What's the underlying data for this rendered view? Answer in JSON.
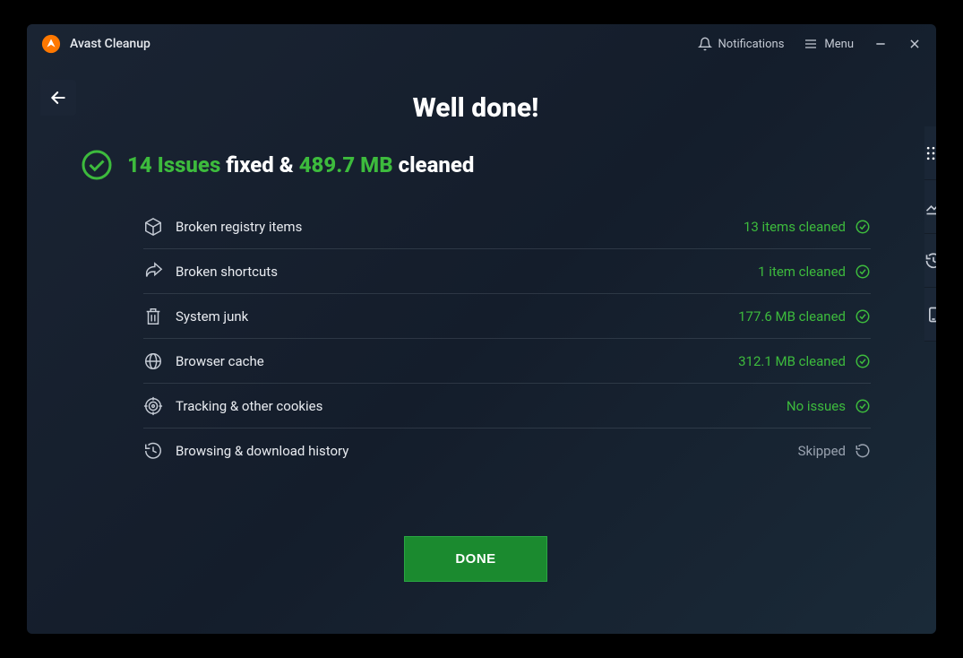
{
  "titlebar": {
    "app_title": "Avast Cleanup",
    "notifications_label": "Notifications",
    "menu_label": "Menu"
  },
  "heading": "Well done!",
  "summary": {
    "issues_count": "14 Issues",
    "middle": " fixed & ",
    "size": "489.7 MB",
    "tail": " cleaned"
  },
  "rows": [
    {
      "label": "Broken registry items",
      "status": "13 items cleaned",
      "status_class": "green",
      "icon": "cube"
    },
    {
      "label": "Broken shortcuts",
      "status": "1 item cleaned",
      "status_class": "green",
      "icon": "share"
    },
    {
      "label": "System junk",
      "status": "177.6 MB cleaned",
      "status_class": "green",
      "icon": "trash"
    },
    {
      "label": "Browser cache",
      "status": "312.1 MB cleaned",
      "status_class": "green",
      "icon": "globe"
    },
    {
      "label": "Tracking & other cookies",
      "status": "No issues",
      "status_class": "green",
      "icon": "target"
    },
    {
      "label": "Browsing & download history",
      "status": "Skipped",
      "status_class": "gray",
      "icon": "history"
    }
  ],
  "done_label": "DONE"
}
